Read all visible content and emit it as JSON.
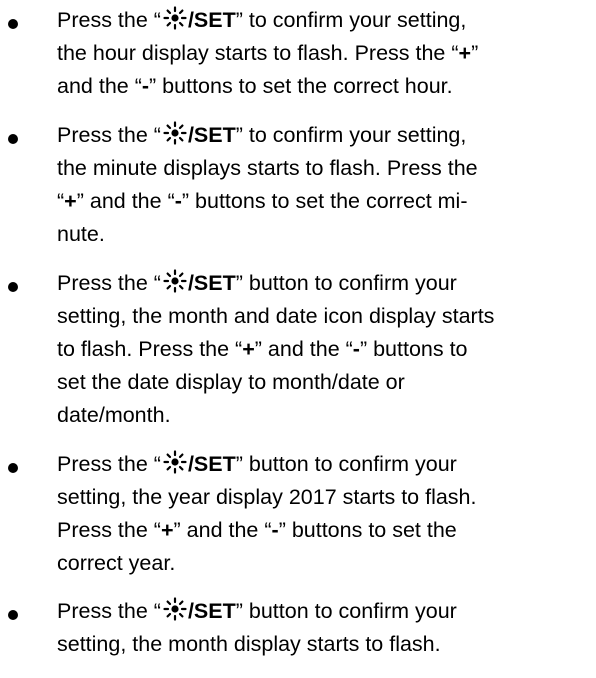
{
  "items": [
    {
      "pre1": "Press the “",
      "button": "/SET",
      "post1": "” to confirm your setting,",
      "line2": "the hour display starts to flash. Press the “",
      "plus": "+",
      "line2b": "”",
      "line3a": "and the “",
      "minus": "-",
      "line3b": "” buttons to set the correct hour."
    },
    {
      "pre1": "Press the “",
      "button": "/SET",
      "post1": "” to confirm your setting,",
      "line2": "the minute displays starts to flash. Press the",
      "line3a": "“",
      "plus": "+",
      "line3b": "” and the “",
      "minus": "-",
      "line3c": "” buttons to set the correct mi-",
      "line4": "nute."
    },
    {
      "pre1": "Press the “",
      "button": "/SET",
      "post1": "” button to confirm your",
      "line2": "setting, the month and date icon display starts",
      "line3a": "to flash. Press the “",
      "plus": "+",
      "line3b": "” and the “",
      "minus": "-",
      "line3c": "” buttons to",
      "line4": "set the date display to month/date or",
      "line5": "date/month."
    },
    {
      "pre1": "Press the “",
      "button": "/SET",
      "post1": "” button to confirm your",
      "line2": "setting, the year display 2017 starts to flash.",
      "line3a": "Press the “",
      "plus": "+",
      "line3b": "” and the “",
      "minus": "-",
      "line3c": "” buttons to set the",
      "line4": "correct year."
    },
    {
      "pre1": "Press the “",
      "button": "/SET",
      "post1": "” button to confirm your",
      "line2": "setting, the month display starts to flash."
    }
  ],
  "icon": "sun-icon"
}
